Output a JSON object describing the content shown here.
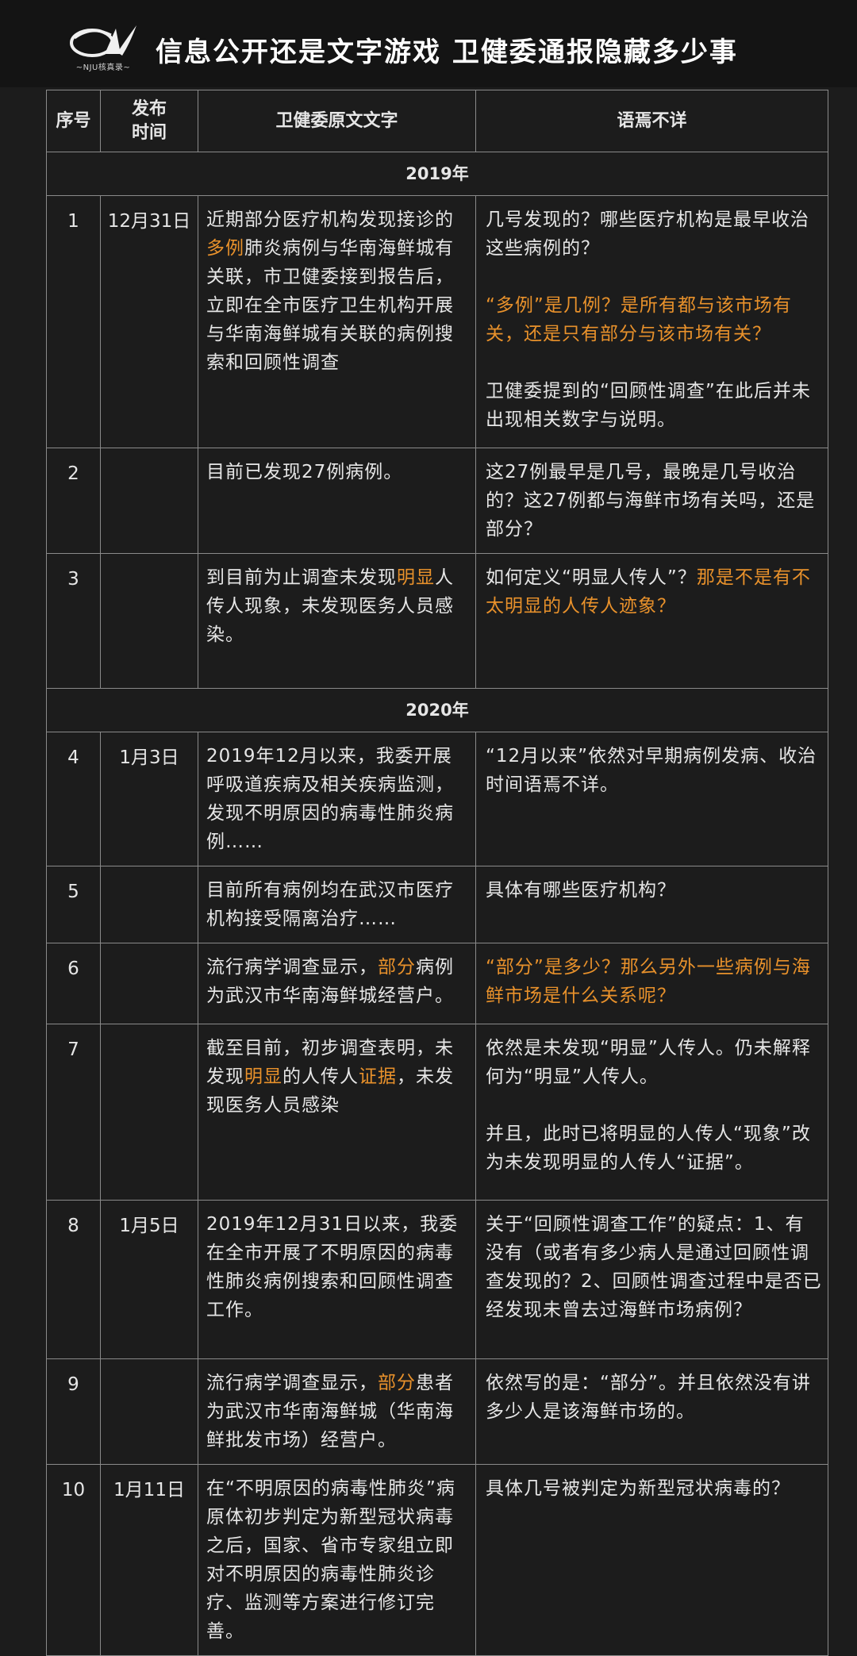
{
  "header": {
    "logo_text": "~NJU核真录~",
    "title": "信息公开还是文字游戏 卫健委通报隐藏多少事"
  },
  "table": {
    "columns": {
      "no": "序号",
      "date_line1": "发布",
      "date_line2": "时间",
      "original": "卫健委原文文字",
      "note": "语焉不详"
    },
    "year_2019": "2019年",
    "year_2020": "2020年",
    "rows": [
      {
        "no": "1",
        "date": "12月31日",
        "original": [
          {
            "t": "近期部分医疗机构发现接诊的"
          },
          {
            "t": "多例",
            "hl": true
          },
          {
            "t": "肺炎病例与华南海鲜城有关联，市卫健委接到报告后，立即在全市医疗卫生机构开展与华南海鲜城有关联的病例搜索和回顾性调查"
          }
        ],
        "note": [
          [
            {
              "t": "几号发现的？哪些医疗机构是最早收治这些病例的？"
            }
          ],
          [
            {
              "t": "“多例”是几例？是所有都与该市场有关，还是只有部分与该市场有关？",
              "hl": true
            }
          ],
          [
            {
              "t": "卫健委提到的“回顾性调查”在此后并未出现相关数字与说明。"
            }
          ]
        ]
      },
      {
        "no": "2",
        "date": "",
        "original": [
          {
            "t": "目前已发现27例病例。"
          }
        ],
        "note": [
          [
            {
              "t": "这27例最早是几号，最晚是几号收治的？这27例都与海鲜市场有关吗，还是部分？"
            }
          ]
        ]
      },
      {
        "no": "3",
        "date": "",
        "original": [
          {
            "t": "到目前为止调查未发现"
          },
          {
            "t": "明显",
            "hl": true
          },
          {
            "t": "人传人现象，未发现医务人员感染。"
          }
        ],
        "note": [
          [
            {
              "t": "如何定义“明显人传人”？"
            },
            {
              "t": "那是不是有不太明显的人传人迹象？",
              "hl": true
            }
          ]
        ]
      },
      {
        "no": "4",
        "date": "1月3日",
        "original": [
          {
            "t": "2019年12月以来，我委开展呼吸道疾病及相关疾病监测，发现不明原因的病毒性肺炎病例……"
          }
        ],
        "note": [
          [
            {
              "t": "“12月以来”依然对早期病例发病、收治时间语焉不详。"
            }
          ]
        ]
      },
      {
        "no": "5",
        "date": "",
        "original": [
          {
            "t": "目前所有病例均在武汉市医疗机构接受隔离治疗……"
          }
        ],
        "note": [
          [
            {
              "t": "具体有哪些医疗机构？"
            }
          ]
        ]
      },
      {
        "no": "6",
        "date": "",
        "original": [
          {
            "t": "流行病学调查显示，"
          },
          {
            "t": "部分",
            "hl": true
          },
          {
            "t": "病例为武汉市华南海鲜城经营户。"
          }
        ],
        "note": [
          [
            {
              "t": "“部分”是多少？那么另外一些病例与海鲜市场是什么关系呢？",
              "hl": true
            }
          ]
        ]
      },
      {
        "no": "7",
        "date": "",
        "original": [
          {
            "t": "截至目前，初步调查表明，未发现"
          },
          {
            "t": "明显",
            "hl": true
          },
          {
            "t": "的人传人"
          },
          {
            "t": "证据",
            "hl": true
          },
          {
            "t": "，未发现医务人员感染"
          }
        ],
        "note": [
          [
            {
              "t": "依然是未发现“明显”人传人。仍未解释何为“明显”人传人。"
            }
          ],
          [
            {
              "t": "并且，此时已将明显的人传人“现象”改为未发现明显的人传人“证据”。"
            }
          ]
        ]
      },
      {
        "no": "8",
        "date": "1月5日",
        "original": [
          {
            "t": "2019年12月31日以来，我委在全市开展了不明原因的病毒性肺炎病例搜索和回顾性调查工作。"
          }
        ],
        "note": [
          [
            {
              "t": "关于“回顾性调查工作”的疑点：1、有没有（或者有多少病人是通过回顾性调查发现的？2、回顾性调查过程中是否已经发现未曾去过海鲜市场病例？"
            }
          ]
        ]
      },
      {
        "no": "9",
        "date": "",
        "original": [
          {
            "t": "流行病学调查显示，"
          },
          {
            "t": "部分",
            "hl": true
          },
          {
            "t": "患者为武汉市华南海鲜城（华南海鲜批发市场）经营户。"
          }
        ],
        "note": [
          [
            {
              "t": "依然写的是：“部分”。并且依然没有讲多少人是该海鲜市场的。"
            }
          ]
        ]
      },
      {
        "no": "10",
        "date": "1月11日",
        "original": [
          {
            "t": "在“不明原因的病毒性肺炎”病原体初步判定为新型冠状病毒之后，国家、省市专家组立即对不明原因的病毒性肺炎诊疗、监测等方案进行修订完善。"
          }
        ],
        "note": [
          [
            {
              "t": "具体几号被判定为新型冠状病毒的？"
            }
          ]
        ]
      }
    ]
  }
}
